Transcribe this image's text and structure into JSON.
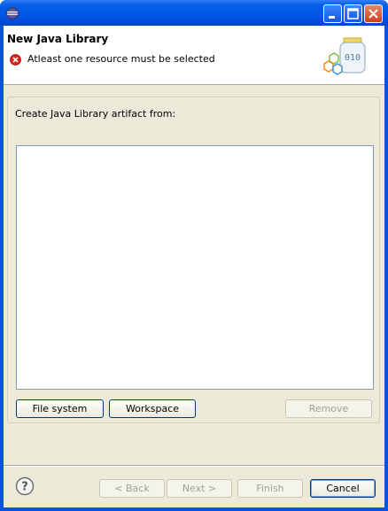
{
  "dialog": {
    "title": "New Java Library",
    "message": "Atleast one resource must be selected"
  },
  "group": {
    "label": "Create Java Library artifact from:",
    "buttons": {
      "file_system": "File system",
      "workspace": "Workspace",
      "remove": "Remove"
    }
  },
  "footer": {
    "back": "< Back",
    "next": "Next >",
    "finish": "Finish",
    "cancel": "Cancel"
  },
  "icons": {
    "app": "eclipse-icon",
    "error": "error-icon",
    "banner": "java-library-jar-icon",
    "help": "help-icon"
  },
  "colors": {
    "titlebar": "#0055e5",
    "dialog_bg": "#ece9d8",
    "error_red": "#d9241c"
  }
}
